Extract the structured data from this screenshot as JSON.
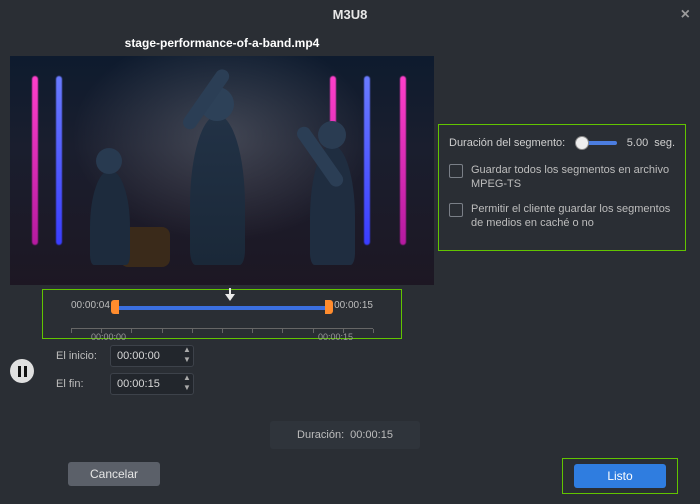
{
  "window": {
    "title": "M3U8"
  },
  "file": {
    "name": "stage-performance-of-a-band.mp4"
  },
  "player": {
    "current_display": "00:00:04",
    "duration_display": "00:00:15",
    "tick_start": "00:00:00",
    "tick_end": "00:00:15"
  },
  "trim": {
    "start_label": "El inicio:",
    "end_label": "El fin:",
    "start_value": "00:00:00",
    "end_value": "00:00:15",
    "duration_label": "Duración:",
    "duration_value": "00:00:15"
  },
  "segment": {
    "label": "Duración del segmento:",
    "value": "5.00",
    "unit": "seg.",
    "checkbox1": "Guardar todos los segmentos en archivo MPEG-TS",
    "checkbox2": "Permitir el cliente guardar los segmentos de medios en caché o no"
  },
  "buttons": {
    "cancel": "Cancelar",
    "ok": "Listo"
  }
}
